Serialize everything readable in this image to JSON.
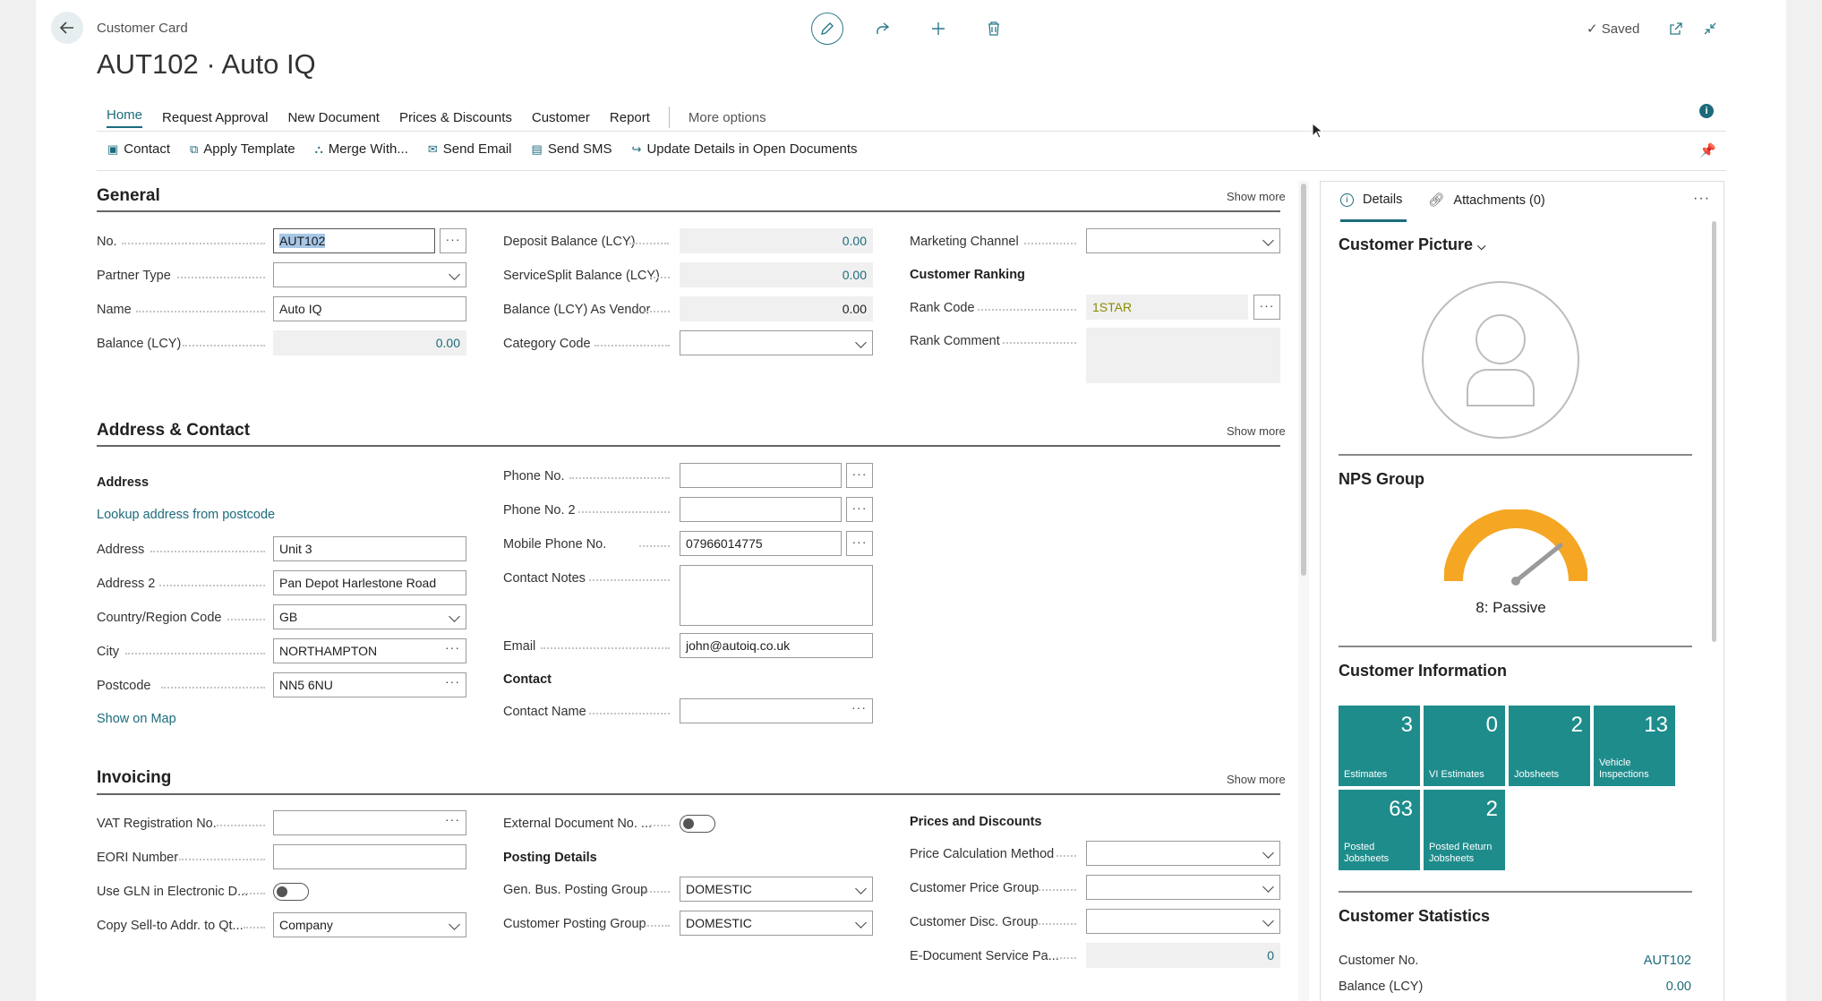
{
  "header": {
    "breadcrumb": "Customer Card",
    "title": "AUT102 · Auto IQ",
    "saved": "Saved"
  },
  "menu": {
    "items": [
      "Home",
      "Request Approval",
      "New Document",
      "Prices & Discounts",
      "Customer",
      "Report"
    ],
    "more": "More options"
  },
  "actions": [
    "Contact",
    "Apply Template",
    "Merge With...",
    "Send Email",
    "Send SMS",
    "Update Details in Open Documents"
  ],
  "general": {
    "title": "General",
    "show_more": "Show more",
    "no_label": "No.",
    "no_value": "AUT102",
    "partner_type_label": "Partner Type",
    "name_label": "Name",
    "name_value": "Auto IQ",
    "balance_label": "Balance (LCY)",
    "balance_value": "0.00",
    "deposit_label": "Deposit Balance (LCY)",
    "deposit_value": "0.00",
    "servicesplit_label": "ServiceSplit Balance (LCY)",
    "servicesplit_value": "0.00",
    "balvendor_label": "Balance (LCY) As Vendor",
    "balvendor_value": "0.00",
    "category_label": "Category Code",
    "marketing_label": "Marketing Channel",
    "ranking_title": "Customer Ranking",
    "rank_code_label": "Rank Code",
    "rank_code_value": "1STAR",
    "rank_comment_label": "Rank Comment"
  },
  "address": {
    "title": "Address & Contact",
    "show_more": "Show more",
    "address_sub": "Address",
    "lookup": "Lookup address from postcode",
    "address_label": "Address",
    "address_value": "Unit 3",
    "address2_label": "Address 2",
    "address2_value": "Pan Depot Harlestone Road",
    "country_label": "Country/Region Code",
    "country_value": "GB",
    "city_label": "City",
    "city_value": "NORTHAMPTON",
    "postcode_label": "Postcode",
    "postcode_value": "NN5 6NU",
    "show_map": "Show on Map",
    "phone_label": "Phone No.",
    "phone2_label": "Phone No. 2",
    "mobile_label": "Mobile Phone No.",
    "mobile_value": "07966014775",
    "notes_label": "Contact Notes",
    "email_label": "Email",
    "email_value": "john@autoiq.co.uk",
    "contact_sub": "Contact",
    "contact_name_label": "Contact Name"
  },
  "invoicing": {
    "title": "Invoicing",
    "show_more": "Show more",
    "vat_label": "VAT Registration No.",
    "eori_label": "EORI Number",
    "gln_label": "Use GLN in Electronic D...",
    "copy_label": "Copy Sell-to Addr. to Qt...",
    "copy_value": "Company",
    "extdoc_label": "External Document No. ...",
    "posting_sub": "Posting Details",
    "genbus_label": "Gen. Bus. Posting Group",
    "genbus_value": "DOMESTIC",
    "custpost_label": "Customer Posting Group",
    "custpost_value": "DOMESTIC",
    "prices_sub": "Prices and Discounts",
    "pricecalc_label": "Price Calculation Method",
    "custprice_label": "Customer Price Group",
    "custdisc_label": "Customer Disc. Group",
    "edoc_label": "E-Document Service Pa...",
    "edoc_value": "0"
  },
  "factbox": {
    "tab_details": "Details",
    "tab_attachments": "Attachments (0)",
    "picture_title": "Customer Picture",
    "nps_title": "NPS Group",
    "nps_value": "8: Passive",
    "nps_score": 8,
    "info_title": "Customer Information",
    "tiles": [
      {
        "num": "3",
        "label": "Estimates"
      },
      {
        "num": "0",
        "label": "VI Estimates"
      },
      {
        "num": "2",
        "label": "Jobsheets"
      },
      {
        "num": "13",
        "label": "Vehicle Inspections"
      },
      {
        "num": "63",
        "label": "Posted Jobsheets"
      },
      {
        "num": "2",
        "label": "Posted Return Jobsheets"
      }
    ],
    "stats_title": "Customer Statistics",
    "stat_no_label": "Customer No.",
    "stat_no_value": "AUT102",
    "stat_bal_label": "Balance (LCY)",
    "stat_bal_value": "0.00"
  },
  "colors": {
    "accent": "#1c6b7a",
    "tile": "#1f8c8c",
    "gauge": "#f5a623"
  }
}
